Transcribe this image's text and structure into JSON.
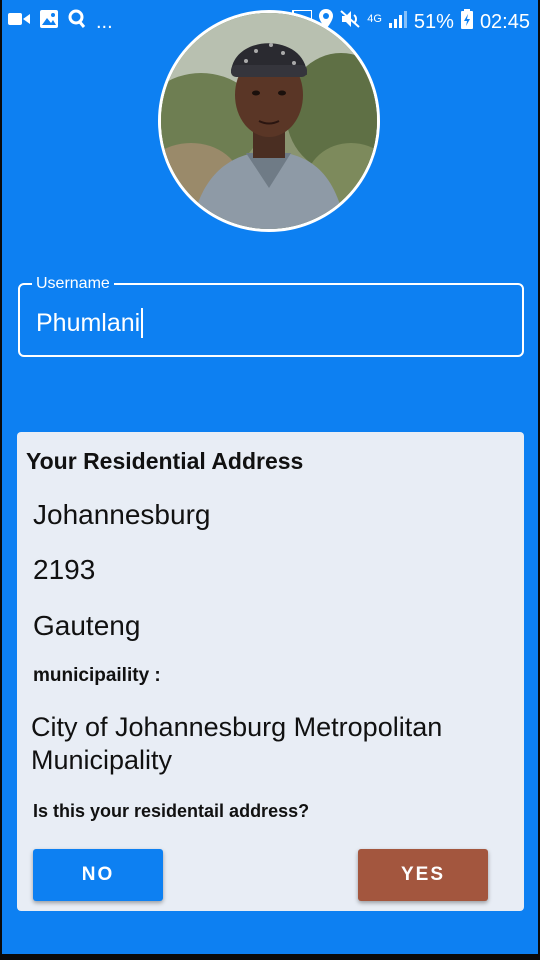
{
  "status_bar": {
    "left_icons": [
      "video-icon",
      "image-icon",
      "search-q-icon"
    ],
    "more": "...",
    "network": "4G",
    "battery": "51%",
    "time": "02:45"
  },
  "profile": {
    "avatar_alt": "profile-photo"
  },
  "username_field": {
    "label": "Username",
    "value": "Phumlani"
  },
  "address_card": {
    "title": "Your Residential Address",
    "city": "Johannesburg",
    "postal_code": "2193",
    "province": "Gauteng",
    "municipality_label": "municipaility :",
    "municipality": "City of Johannesburg Metropolitan Municipality",
    "question": "Is this your residentail address?",
    "no_label": "NO",
    "yes_label": "YES"
  },
  "colors": {
    "background": "#0d80f2",
    "card": "#e8edf5",
    "no_button": "#0d80f2",
    "yes_button": "#a3563e"
  }
}
